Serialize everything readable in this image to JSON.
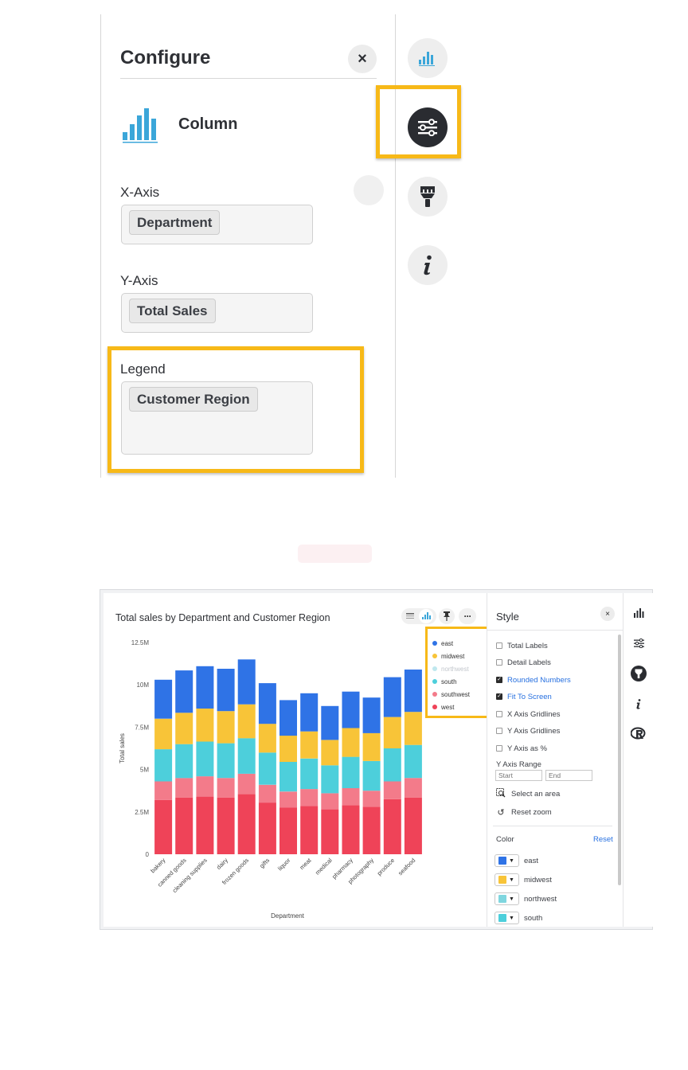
{
  "configure": {
    "title": "Configure",
    "close": "×",
    "chart_type": "Column",
    "x_axis": {
      "label": "X-Axis",
      "chip": "Department"
    },
    "y_axis": {
      "label": "Y-Axis",
      "chip": "Total Sales"
    },
    "legend": {
      "label": "Legend",
      "chip": "Customer Region"
    },
    "rail_icons": [
      "chart-icon",
      "settings-sliders-icon",
      "paintbrush-icon",
      "info-icon"
    ]
  },
  "chart": {
    "title": "Total sales by Department and Customer Region",
    "toolbar": {
      "more": "···"
    },
    "chart_data": {
      "type": "bar",
      "stacked": true,
      "title": "Total sales by Department and Customer Region",
      "xlabel": "Department",
      "ylabel": "Total sales",
      "ylim": [
        0,
        12500000
      ],
      "yticks": [
        "0",
        "2.5M",
        "5M",
        "7.5M",
        "10M",
        "12.5M"
      ],
      "ytick_values": [
        0,
        2500000,
        5000000,
        7500000,
        10000000,
        12500000
      ],
      "legend_position": "top-right",
      "categories": [
        "bakery",
        "canned goods",
        "cleaning supplies",
        "dairy",
        "frozen goods",
        "gifts",
        "liquor",
        "meat",
        "medical",
        "pharmacy",
        "photography",
        "produce",
        "seafood"
      ],
      "series": [
        {
          "name": "west",
          "color": "#ef4358",
          "values": [
            3200000,
            3350000,
            3400000,
            3350000,
            3550000,
            3050000,
            2750000,
            2850000,
            2650000,
            2900000,
            2800000,
            3250000,
            3350000
          ]
        },
        {
          "name": "southwest",
          "color": "#f37b8a",
          "values": [
            1100000,
            1150000,
            1200000,
            1150000,
            1200000,
            1050000,
            950000,
            1000000,
            950000,
            1000000,
            950000,
            1050000,
            1150000
          ]
        },
        {
          "name": "south",
          "color": "#4dcfdb",
          "values": [
            1900000,
            2000000,
            2050000,
            2050000,
            2100000,
            1900000,
            1750000,
            1800000,
            1650000,
            1850000,
            1750000,
            1950000,
            1950000
          ]
        },
        {
          "name": "northwest",
          "color": "#bfe8ee",
          "values": [
            0,
            0,
            0,
            0,
            0,
            0,
            0,
            0,
            0,
            0,
            0,
            0,
            0
          ]
        },
        {
          "name": "midwest",
          "color": "#f8c438",
          "values": [
            1800000,
            1850000,
            1950000,
            1900000,
            2000000,
            1700000,
            1550000,
            1600000,
            1500000,
            1700000,
            1650000,
            1850000,
            1950000
          ]
        },
        {
          "name": "east",
          "color": "#2f73e6",
          "values": [
            2300000,
            2500000,
            2500000,
            2500000,
            2650000,
            2400000,
            2100000,
            2250000,
            2000000,
            2150000,
            2100000,
            2350000,
            2500000
          ]
        }
      ],
      "legend": [
        {
          "name": "east",
          "color": "#2f73e6",
          "muted": false
        },
        {
          "name": "midwest",
          "color": "#f8c438",
          "muted": false
        },
        {
          "name": "northwest",
          "color": "#bfe8ee",
          "muted": true
        },
        {
          "name": "south",
          "color": "#4dcfdb",
          "muted": false
        },
        {
          "name": "southwest",
          "color": "#f37b8a",
          "muted": false
        },
        {
          "name": "west",
          "color": "#ef4358",
          "muted": false
        }
      ]
    }
  },
  "style_panel": {
    "title": "Style",
    "close": "×",
    "options": [
      {
        "label": "Total Labels",
        "checked": false
      },
      {
        "label": "Detail Labels",
        "checked": false
      },
      {
        "label": "Rounded Numbers",
        "checked": true
      },
      {
        "label": "Fit To Screen",
        "checked": true
      },
      {
        "label": "X Axis Gridlines",
        "checked": false
      },
      {
        "label": "Y Axis Gridlines",
        "checked": false
      },
      {
        "label": "Y Axis as %",
        "checked": false
      }
    ],
    "y_range": {
      "label": "Y Axis Range",
      "start_placeholder": "Start",
      "end_placeholder": "End"
    },
    "select_area": "Select an area",
    "reset_zoom": "Reset zoom",
    "color": {
      "label": "Color",
      "reset": "Reset"
    },
    "swatches": [
      {
        "name": "east",
        "color": "#2f73e6"
      },
      {
        "name": "midwest",
        "color": "#f8c438"
      },
      {
        "name": "northwest",
        "color": "#7fd6df"
      },
      {
        "name": "south",
        "color": "#4dcfdb"
      }
    ]
  },
  "colors": {
    "highlight": "#f7b918",
    "accent": "#2770e0",
    "dark_icon": "#2a2c31"
  }
}
